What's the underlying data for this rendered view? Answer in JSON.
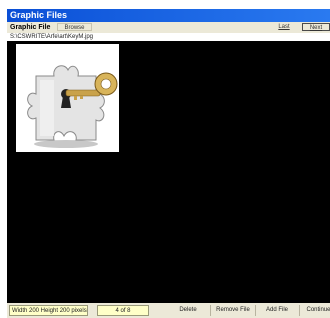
{
  "window": {
    "title": "Graphic Files"
  },
  "toolbar": {
    "label": "Graphic File",
    "browse_label": "Browse",
    "last_label": "Last",
    "next_label": "Next"
  },
  "path": {
    "value": "S:\\CSWRITE\\Arfe\\art\\KeyM.jpg"
  },
  "status": {
    "dimensions": "Width 200 Height 200 pixels",
    "counter": "4 of 8"
  },
  "buttons": {
    "delete": "Delete",
    "remove_file": "Remove File",
    "add_file": "Add File",
    "continue": "Continue"
  },
  "colors": {
    "title_bar": "#0a4fd6",
    "preview_bg": "#000000",
    "status_field_bg": "#ffffc8",
    "chrome_bg": "#ece9d8"
  }
}
